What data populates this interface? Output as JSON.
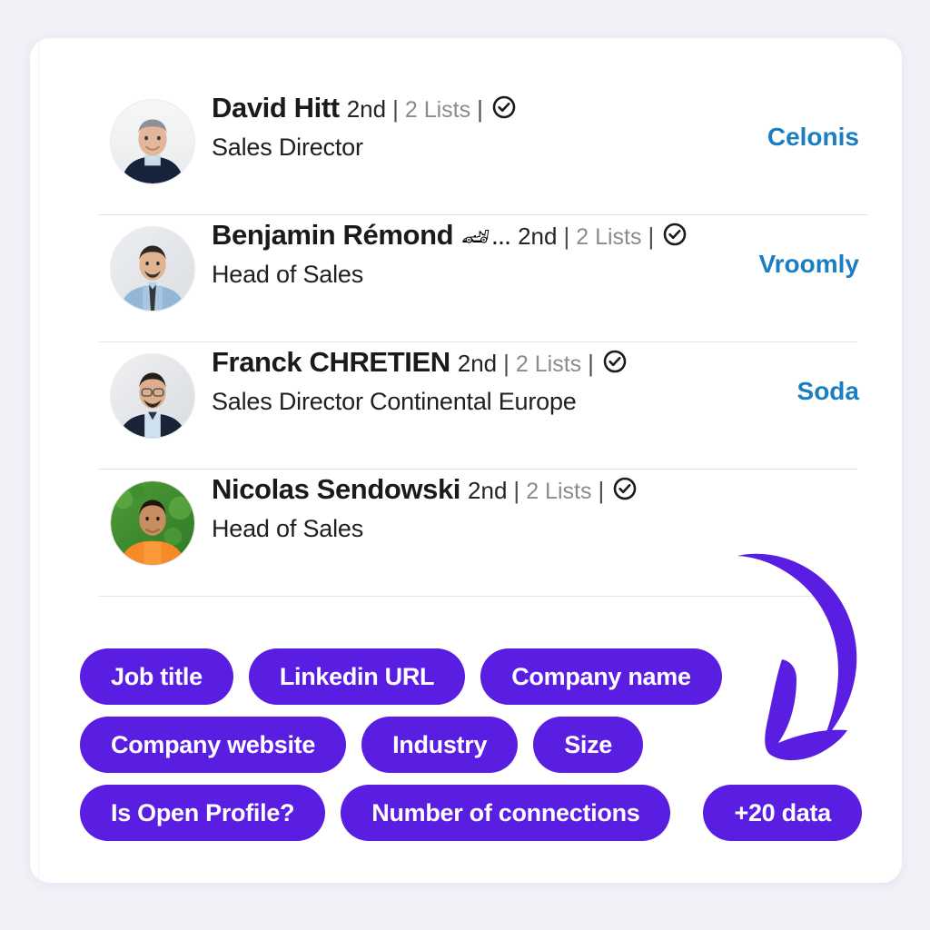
{
  "theme": {
    "background": "#f1f1f8",
    "card_background": "#ffffff",
    "tag_purple": "#5a1ee3",
    "company_blue": "#1a7ec2",
    "divider": "#e3e3e6",
    "muted_text": "#8b8b8b"
  },
  "people": [
    {
      "name": "David Hitt",
      "emoji": "",
      "ellipsis": "",
      "degree": "2nd",
      "separator": "|",
      "lists": "2 Lists",
      "verified_icon": "check-circle-icon",
      "title": "Sales Director",
      "company": "Celonis",
      "avatar_icon": "avatar-photo"
    },
    {
      "name": "Benjamin Rémond",
      "emoji": "🏎",
      "ellipsis": "...",
      "degree": "2nd",
      "separator": "|",
      "lists": "2 Lists",
      "verified_icon": "check-circle-icon",
      "title": "Head of Sales",
      "company": "Vroomly",
      "avatar_icon": "avatar-photo"
    },
    {
      "name": "Franck CHRETIEN",
      "emoji": "",
      "ellipsis": "",
      "degree": "2nd",
      "separator": "|",
      "lists": "2 Lists",
      "verified_icon": "check-circle-icon",
      "title": "Sales Director Continental Europe",
      "company": "Soda",
      "avatar_icon": "avatar-photo"
    },
    {
      "name": "Nicolas Sendowski",
      "emoji": "",
      "ellipsis": "",
      "degree": "2nd",
      "separator": "|",
      "lists": "2 Lists",
      "verified_icon": "check-circle-icon",
      "title": "Head of Sales",
      "company": "",
      "avatar_icon": "avatar-photo"
    }
  ],
  "tags": {
    "row1": [
      "Job title",
      "Linkedin URL",
      "Company name"
    ],
    "row2": [
      "Company website",
      "Industry",
      "Size"
    ],
    "row3": [
      "Is Open Profile?",
      "Number of connections",
      "+20 data"
    ]
  },
  "annotation": {
    "arrow_icon": "curved-down-arrow-icon"
  }
}
